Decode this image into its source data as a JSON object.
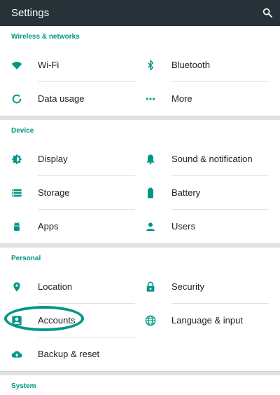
{
  "app_bar": {
    "title": "Settings",
    "search_icon": "search-icon"
  },
  "accent": "#009688",
  "sections": {
    "wireless": {
      "header": "Wireless & networks",
      "items": [
        {
          "label": "Wi-Fi",
          "icon": "wifi-icon"
        },
        {
          "label": "Bluetooth",
          "icon": "bluetooth-icon"
        },
        {
          "label": "Data usage",
          "icon": "data-usage-icon"
        },
        {
          "label": "More",
          "icon": "more-dots-icon"
        }
      ]
    },
    "device": {
      "header": "Device",
      "items": [
        {
          "label": "Display",
          "icon": "display-brightness-icon"
        },
        {
          "label": "Sound & notification",
          "icon": "bell-icon"
        },
        {
          "label": "Storage",
          "icon": "storage-icon"
        },
        {
          "label": "Battery",
          "icon": "battery-icon"
        },
        {
          "label": "Apps",
          "icon": "android-icon"
        },
        {
          "label": "Users",
          "icon": "user-icon"
        }
      ]
    },
    "personal": {
      "header": "Personal",
      "items": [
        {
          "label": "Location",
          "icon": "location-pin-icon"
        },
        {
          "label": "Security",
          "icon": "lock-icon"
        },
        {
          "label": "Accounts",
          "icon": "account-box-icon"
        },
        {
          "label": "Language & input",
          "icon": "globe-icon"
        },
        {
          "label": "Backup & reset",
          "icon": "cloud-upload-icon"
        }
      ]
    },
    "system": {
      "header": "System"
    }
  }
}
